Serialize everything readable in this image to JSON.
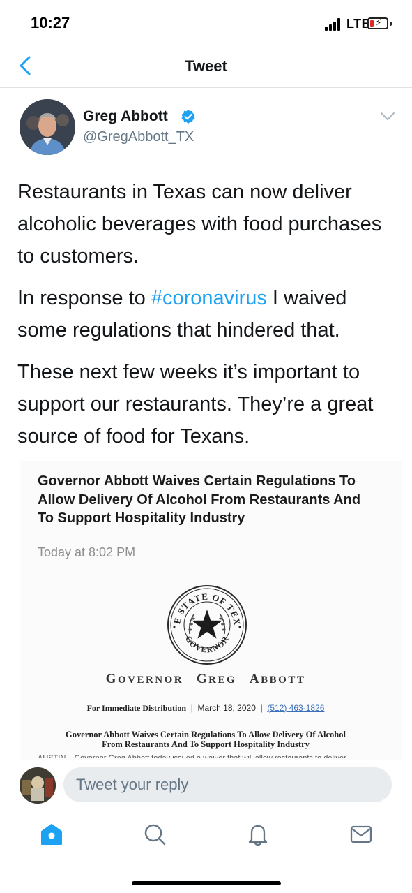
{
  "status_bar": {
    "time": "10:27",
    "network": "LTE",
    "battery_level": 0.2,
    "battery_color": "#e0282c"
  },
  "nav": {
    "back_icon": "chevron-left-icon",
    "title": "Tweet",
    "accent_color": "#1da1f2"
  },
  "tweet": {
    "author": {
      "name": "Greg Abbott",
      "handle": "@GregAbbott_TX",
      "verified": true
    },
    "paragraphs": [
      "Restaurants in Texas can now deliver alcoholic beverages with food purchases to customers.",
      "These next few weeks it’s important to support our restaurants. They’re a great source of food for Texans."
    ],
    "p2_prefix": "In response to ",
    "hashtag": "#coronavirus",
    "p2_suffix": " I waived some regulations that hindered that.",
    "attachment": {
      "title": "Governor Abbott Waives Certain Regulations To Allow Delivery Of Alcohol From Restaurants And To Support Hospitality Industry",
      "timestamp": "Today at 8:02 PM",
      "seal_text_top": "THE STATE OF TEXAS",
      "seal_text_bottom": "GOVERNOR",
      "office": {
        "g": "G",
        "overnor": "OVERNOR",
        "g2": "G",
        "reg": "REG",
        "a": "A",
        "bbott": "BBOTT"
      },
      "distribution": "For Immediate Distribution",
      "date": "March 18, 2020",
      "phone": "(512) 463-1826",
      "release_title_line1": "Governor Abbott Waives Certain Regulations To Allow Delivery Of Alcohol",
      "release_title_line2": "From Restaurants And To Support Hospitality Industry",
      "cut_text": "AUSTIN – Governor Greg Abbott today issued a waiver that will allow restaurants to deliver"
    }
  },
  "reply": {
    "placeholder": "Tweet your reply"
  },
  "tabs": [
    {
      "name": "home",
      "icon": "home-icon",
      "active": true
    },
    {
      "name": "search",
      "icon": "search-icon",
      "active": false
    },
    {
      "name": "notifications",
      "icon": "bell-icon",
      "active": false
    },
    {
      "name": "messages",
      "icon": "mail-icon",
      "active": false
    }
  ]
}
